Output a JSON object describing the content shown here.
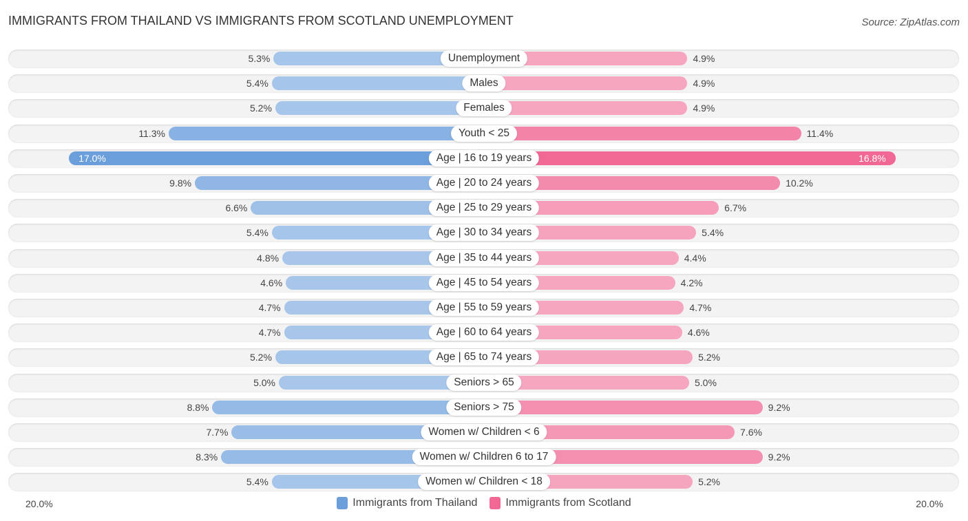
{
  "header": {
    "title": "IMMIGRANTS FROM THAILAND VS IMMIGRANTS FROM SCOTLAND UNEMPLOYMENT",
    "source": "Source: ZipAtlas.com"
  },
  "colors": {
    "thailand": "#6a9fdc",
    "thailand_light": "#a7c6ea",
    "scotland": "#f06893",
    "scotland_light": "#f6a6bf"
  },
  "chart_data": {
    "type": "bar",
    "orientation": "horizontal-diverging",
    "title": "IMMIGRANTS FROM THAILAND VS IMMIGRANTS FROM SCOTLAND UNEMPLOYMENT",
    "categories": [
      "Unemployment",
      "Males",
      "Females",
      "Youth < 25",
      "Age | 16 to 19 years",
      "Age | 20 to 24 years",
      "Age | 25 to 29 years",
      "Age | 30 to 34 years",
      "Age | 35 to 44 years",
      "Age | 45 to 54 years",
      "Age | 55 to 59 years",
      "Age | 60 to 64 years",
      "Age | 65 to 74 years",
      "Seniors > 65",
      "Seniors > 75",
      "Women w/ Children < 6",
      "Women w/ Children 6 to 17",
      "Women w/ Children < 18"
    ],
    "series": [
      {
        "name": "Immigrants from Thailand",
        "side": "left",
        "values": [
          5.3,
          5.4,
          5.2,
          11.3,
          17.0,
          9.8,
          6.6,
          5.4,
          4.8,
          4.6,
          4.7,
          4.7,
          5.2,
          5.0,
          8.8,
          7.7,
          8.3,
          5.4
        ],
        "labels": [
          "5.3%",
          "5.4%",
          "5.2%",
          "11.3%",
          "17.0%",
          "9.8%",
          "6.6%",
          "5.4%",
          "4.8%",
          "4.6%",
          "4.7%",
          "4.7%",
          "5.2%",
          "5.0%",
          "8.8%",
          "7.7%",
          "8.3%",
          "5.4%"
        ]
      },
      {
        "name": "Immigrants from Scotland",
        "side": "right",
        "values": [
          4.9,
          4.9,
          4.9,
          11.4,
          16.8,
          10.2,
          6.7,
          5.4,
          4.4,
          4.2,
          4.7,
          4.6,
          5.2,
          5.0,
          9.2,
          7.6,
          9.2,
          5.2
        ],
        "labels": [
          "4.9%",
          "4.9%",
          "4.9%",
          "11.4%",
          "16.8%",
          "10.2%",
          "6.7%",
          "5.4%",
          "4.4%",
          "4.2%",
          "4.7%",
          "4.6%",
          "5.2%",
          "5.0%",
          "9.2%",
          "7.6%",
          "9.2%",
          "5.2%"
        ]
      }
    ],
    "xlim": [
      0,
      20.0
    ],
    "axis_labels": {
      "left": "20.0%",
      "right": "20.0%"
    },
    "legend": {
      "position": "bottom-center",
      "entries": [
        "Immigrants from Thailand",
        "Immigrants from Scotland"
      ]
    },
    "grid": false
  }
}
